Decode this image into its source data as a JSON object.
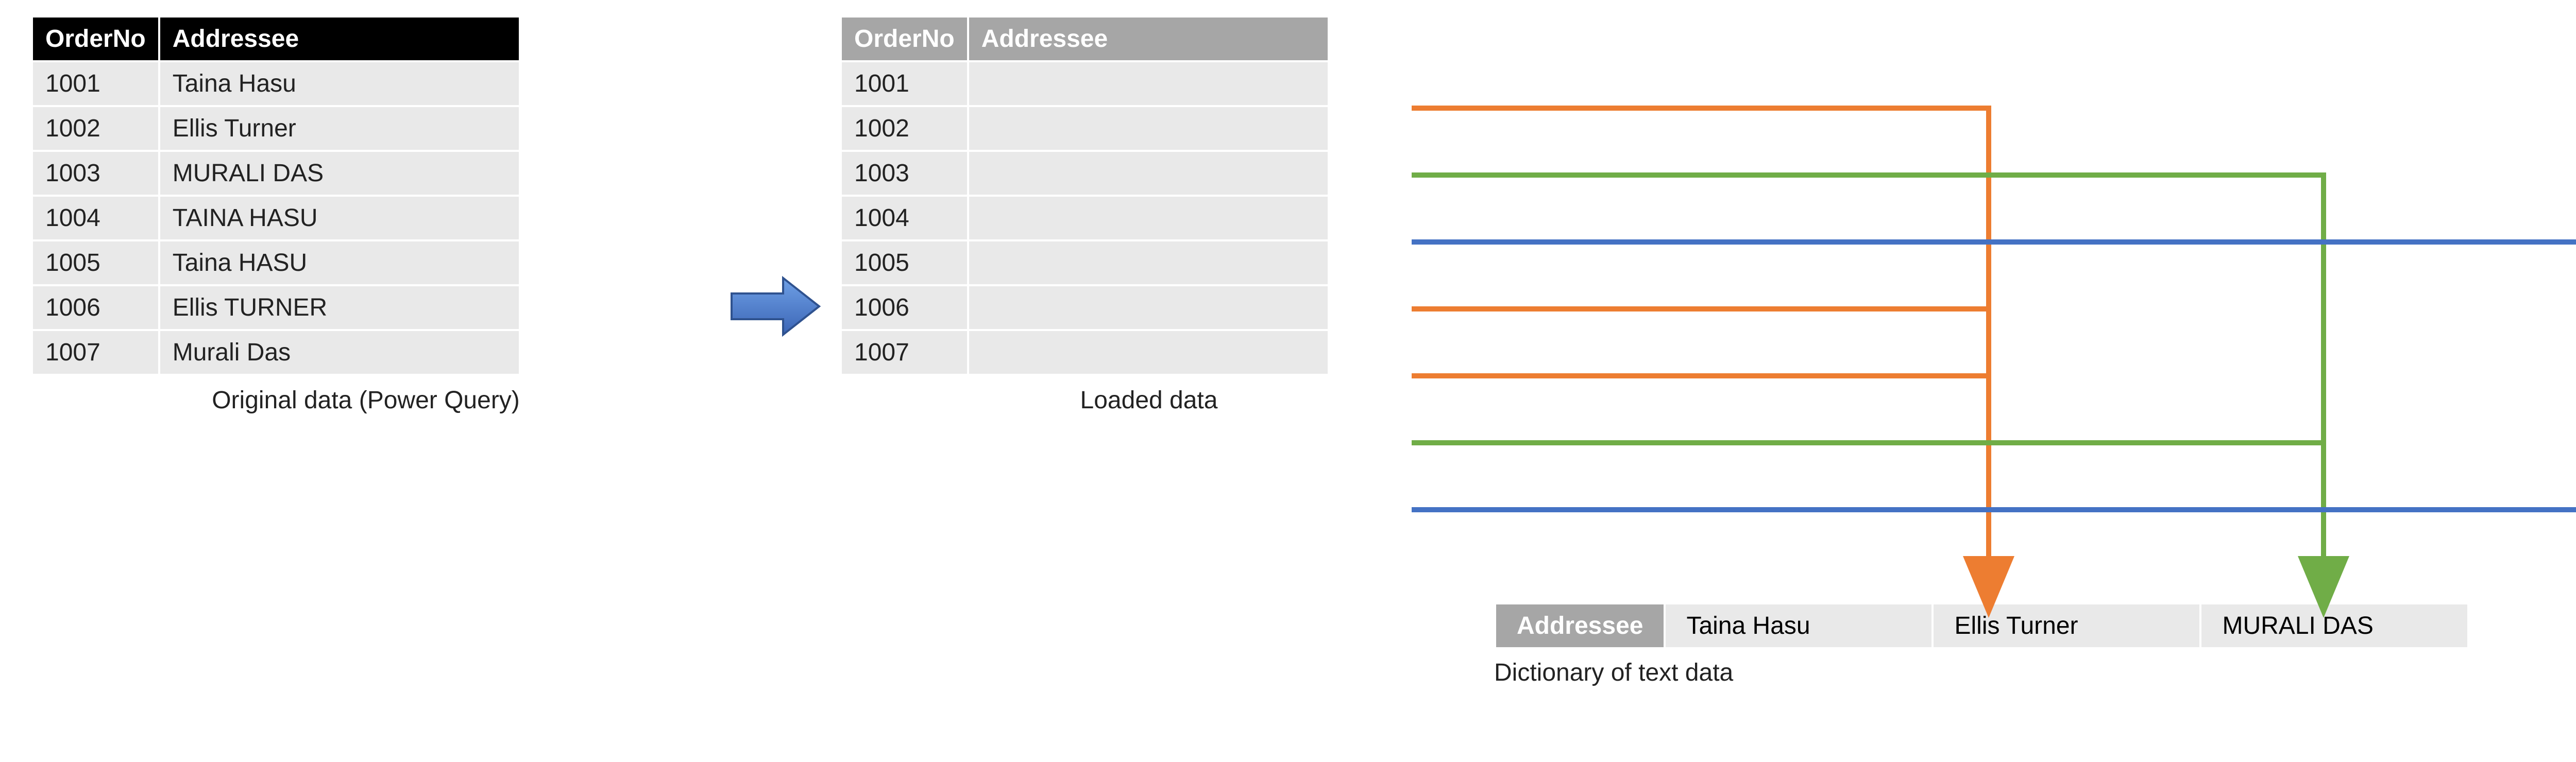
{
  "left_table": {
    "caption": "Original data (Power Query)",
    "headers": {
      "col1": "OrderNo",
      "col2": "Addressee"
    },
    "rows": [
      {
        "order": "1001",
        "name": "Taina Hasu"
      },
      {
        "order": "1002",
        "name": "Ellis Turner"
      },
      {
        "order": "1003",
        "name": "MURALI DAS"
      },
      {
        "order": "1004",
        "name": "TAINA HASU"
      },
      {
        "order": "1005",
        "name": "Taina HASU"
      },
      {
        "order": "1006",
        "name": "Ellis TURNER"
      },
      {
        "order": "1007",
        "name": "Murali Das"
      }
    ]
  },
  "right_table": {
    "caption": "Loaded data",
    "headers": {
      "col1": "OrderNo",
      "col2": "Addressee"
    },
    "rows": [
      {
        "order": "1001",
        "name": ""
      },
      {
        "order": "1002",
        "name": ""
      },
      {
        "order": "1003",
        "name": ""
      },
      {
        "order": "1004",
        "name": ""
      },
      {
        "order": "1005",
        "name": ""
      },
      {
        "order": "1006",
        "name": ""
      },
      {
        "order": "1007",
        "name": ""
      }
    ]
  },
  "dictionary": {
    "caption": "Dictionary of text data",
    "header": "Addressee",
    "items": [
      "Taina Hasu",
      "Ellis Turner",
      "MURALI DAS"
    ]
  },
  "arrow_colors": {
    "orange": "#ed7d31",
    "green": "#70ad47",
    "blue": "#4472c4"
  },
  "big_arrow_color": "#4472c4",
  "chart_data": {
    "type": "table",
    "description": "Diagram showing how original text column is deduplicated into a dictionary and rows reference dictionary entries",
    "mapping": [
      {
        "order": "1001",
        "dict_index": 0,
        "color": "orange"
      },
      {
        "order": "1002",
        "dict_index": 1,
        "color": "green"
      },
      {
        "order": "1003",
        "dict_index": 2,
        "color": "blue"
      },
      {
        "order": "1004",
        "dict_index": 0,
        "color": "orange"
      },
      {
        "order": "1005",
        "dict_index": 0,
        "color": "orange"
      },
      {
        "order": "1006",
        "dict_index": 1,
        "color": "green"
      },
      {
        "order": "1007",
        "dict_index": 2,
        "color": "blue"
      }
    ]
  }
}
